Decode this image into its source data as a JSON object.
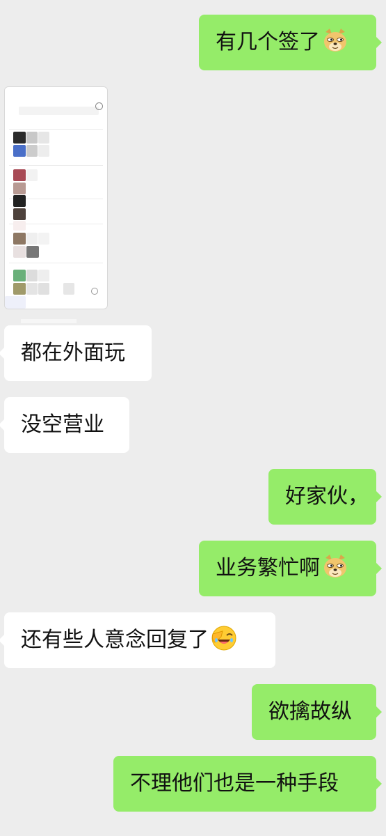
{
  "messages": [
    {
      "side": "sent",
      "text": "有几个签了",
      "emoji": "doge-icon"
    },
    {
      "side": "recv",
      "type": "image",
      "label": "blurred-screenshot"
    },
    {
      "side": "recv",
      "text": "都在外面玩"
    },
    {
      "side": "recv",
      "text": "没空营业"
    },
    {
      "side": "sent",
      "text": "好家伙，"
    },
    {
      "side": "sent",
      "text": "业务繁忙啊",
      "emoji": "doge-icon"
    },
    {
      "side": "recv",
      "text": "还有些人意念回复了",
      "emoji": "facepalm-laugh-icon"
    },
    {
      "side": "sent",
      "text": "欲擒故纵"
    },
    {
      "side": "sent",
      "text": "不理他们也是一种手段"
    }
  ],
  "colors": {
    "background": "#ededed",
    "sent_bubble": "#95ec69",
    "received_bubble": "#ffffff",
    "text": "#111111"
  }
}
